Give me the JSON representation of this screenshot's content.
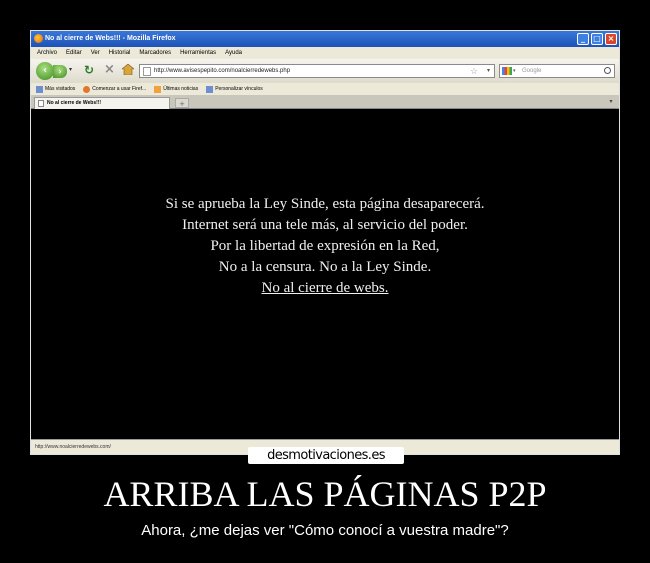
{
  "browser": {
    "window_title": "No al cierre de Webs!!! - Mozilla Firefox",
    "menu": [
      "Archivo",
      "Editar",
      "Ver",
      "Historial",
      "Marcadores",
      "Herramientas",
      "Ayuda"
    ],
    "url": "http://www.avisespepito.com/noalcierredewebs.php",
    "search_placeholder": "Google",
    "bookmarks": [
      "Más visitados",
      "Comenzar a usar Firef...",
      "Últimas noticias",
      "Personalizar vínculos"
    ],
    "tab_title": "No al cierre de Webs!!!",
    "new_tab_label": "+",
    "status_text": "http://www.noalcierredewebs.com/"
  },
  "page": {
    "lines": [
      "Si se aprueba la Ley Sinde, esta página desaparecerá.",
      "Internet será una tele más, al servicio del poder.",
      "Por la libertad de expresión en la Red,",
      "No a la censura. No a la Ley Sinde."
    ],
    "link": "No al cierre de webs."
  },
  "poster": {
    "logo": "desmotivaciones.es",
    "headline": "ARRIBA LAS PÁGINAS P2P",
    "caption": "Ahora, ¿me dejas ver \"Cómo conocí a vuestra madre\"?"
  }
}
